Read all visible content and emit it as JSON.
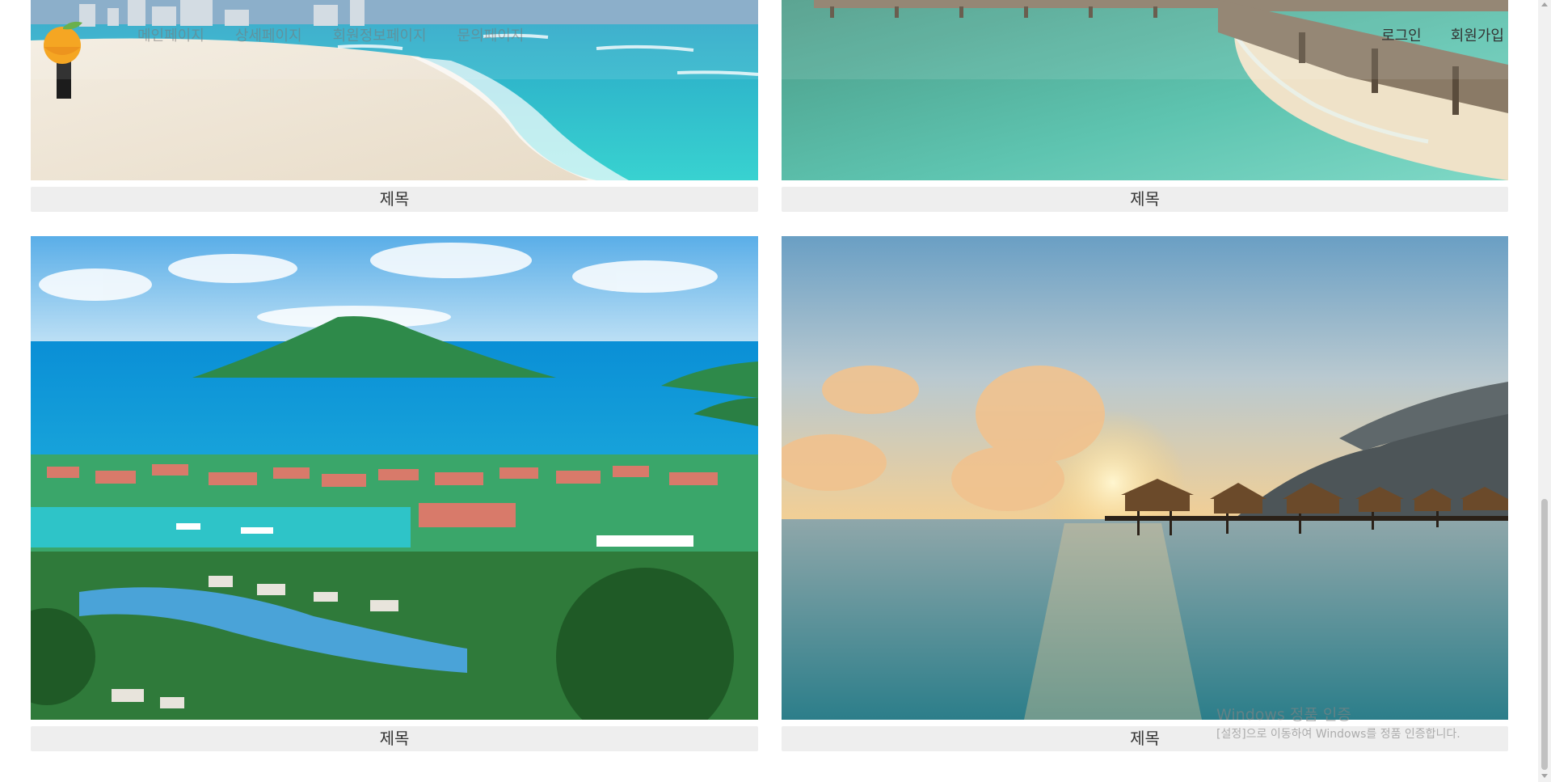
{
  "header": {
    "logo_icon": "orange-fruit-logo",
    "nav": [
      {
        "label": "메인페이지"
      },
      {
        "label": "상세페이지"
      },
      {
        "label": "회원정보페이지"
      },
      {
        "label": "문의페이지"
      }
    ],
    "auth": {
      "login_label": "로그인",
      "signup_label": "회원가입"
    }
  },
  "gallery": {
    "cards": [
      {
        "title": "제목",
        "image": "tropical-beach-with-city-skyline"
      },
      {
        "title": "제목",
        "image": "wooden-pier-over-turquoise-lagoon"
      },
      {
        "title": "제목",
        "image": "aerial-view-of-island-marina"
      },
      {
        "title": "제목",
        "image": "overwater-bungalows-at-sunset"
      }
    ]
  },
  "watermark": {
    "line1": "Windows 정품 인증",
    "line2": "[설정]으로 이동하여 Windows를 정품 인증합니다."
  },
  "colors": {
    "caption_bg": "#eeeeee",
    "caption_text": "#333333",
    "logo_orange": "#f5a623",
    "leaf_green": "#6ab04c"
  }
}
